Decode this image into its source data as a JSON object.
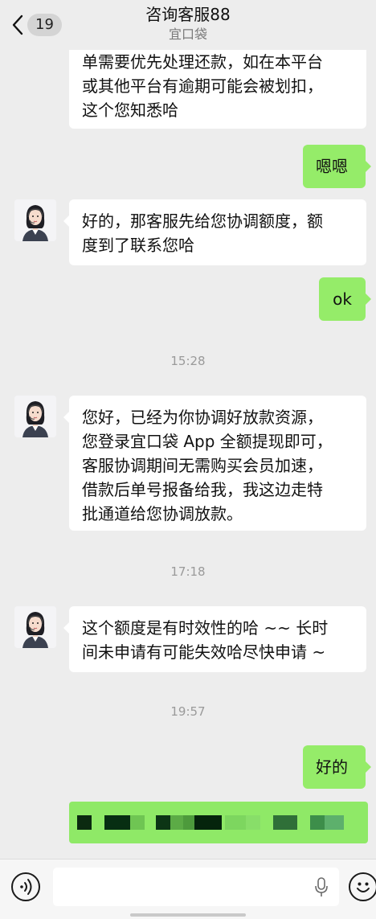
{
  "header": {
    "unread_count": "19",
    "title": "咨询客服88",
    "subtitle": "宜口袋"
  },
  "messages": [
    {
      "from": "agent",
      "text": "单需要优先处理还款，如在本平台\n或其他平台有逾期可能会被划扣，\n这个您知悉哈"
    },
    {
      "from": "me",
      "text": "嗯嗯"
    },
    {
      "from": "agent",
      "text": "好的，那客服先给您协调额度，额\n度到了联系您哈"
    },
    {
      "from": "me",
      "text": "ok"
    },
    {
      "type": "time",
      "text": "15:28"
    },
    {
      "from": "agent",
      "text": "您好，已经为你协调好放款资源，\n您登录宜口袋 App 全额提现即可，\n客服协调期间无需购买会员加速，\n借款后单号报备给我，我这边走特\n批通道给您协调放款。"
    },
    {
      "type": "time",
      "text": "17:18"
    },
    {
      "from": "agent",
      "text": "这个额度是有时效性的哈 ~~ 长时\n间未申请有可能失效哈尽快申请 ~"
    },
    {
      "type": "time",
      "text": "19:57"
    },
    {
      "from": "me",
      "text": "好的"
    },
    {
      "from": "me",
      "redacted": true
    }
  ],
  "icons": {
    "back": "chevron-left-icon",
    "voice": "voice-icon",
    "mic": "microphone-icon",
    "emoji": "emoji-icon"
  },
  "colors": {
    "background": "#ededed",
    "incoming_bubble": "#ffffff",
    "outgoing_bubble": "#95ec69",
    "timestamp": "#9a9a9a"
  }
}
